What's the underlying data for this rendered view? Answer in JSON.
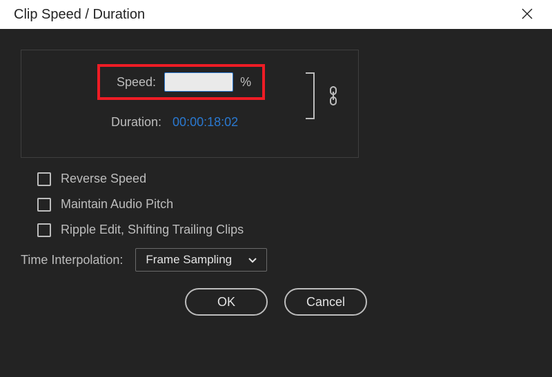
{
  "titlebar": {
    "title": "Clip Speed / Duration"
  },
  "group": {
    "speed_label": "Speed:",
    "speed_value": "",
    "percent_sign": "%",
    "duration_label": "Duration:",
    "duration_value": "00:00:18:02"
  },
  "checkboxes": {
    "reverse": "Reverse Speed",
    "pitch": "Maintain Audio Pitch",
    "ripple": "Ripple Edit, Shifting Trailing Clips"
  },
  "interp": {
    "label": "Time Interpolation:",
    "selected": "Frame Sampling"
  },
  "buttons": {
    "ok": "OK",
    "cancel": "Cancel"
  }
}
